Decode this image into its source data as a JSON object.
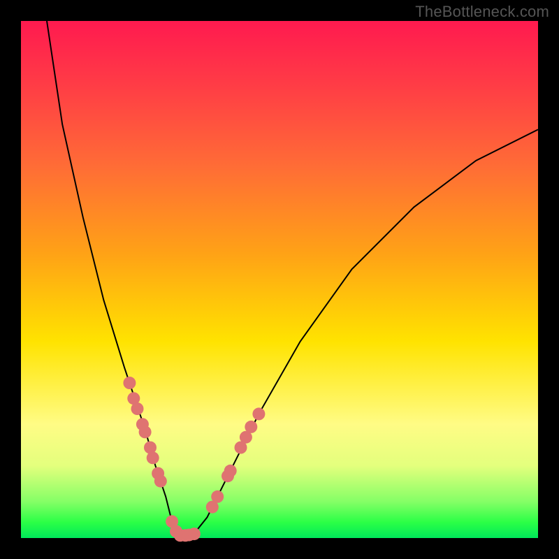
{
  "watermark": "TheBottleneck.com",
  "colors": {
    "frame": "#000000",
    "dot_fill": "#df7371",
    "curve_stroke": "#000000",
    "gradient_top": "#ff1a4f",
    "gradient_bottom": "#00e85a"
  },
  "chart_data": {
    "type": "line",
    "title": "",
    "xlabel": "",
    "ylabel": "",
    "xlim": [
      0,
      100
    ],
    "ylim": [
      0,
      100
    ],
    "grid": false,
    "legend": false,
    "series": [
      {
        "name": "bottleneck-curve",
        "x": [
          5,
          8,
          12,
          16,
          20,
          24,
          26,
          28,
          29,
          30,
          31,
          32,
          34,
          36,
          40,
          46,
          54,
          64,
          76,
          88,
          100
        ],
        "y": [
          100,
          80,
          62,
          46,
          33,
          21,
          14,
          8,
          4,
          1.5,
          0.5,
          0.5,
          1.5,
          4,
          12,
          24,
          38,
          52,
          64,
          73,
          79
        ]
      }
    ],
    "points": [
      {
        "name": "left-cluster",
        "x": 21.0,
        "y": 30
      },
      {
        "name": "left-cluster",
        "x": 21.8,
        "y": 27
      },
      {
        "name": "left-cluster",
        "x": 22.5,
        "y": 25
      },
      {
        "name": "left-cluster",
        "x": 23.5,
        "y": 22
      },
      {
        "name": "left-cluster",
        "x": 24.0,
        "y": 20.5
      },
      {
        "name": "left-cluster",
        "x": 25.0,
        "y": 17.5
      },
      {
        "name": "left-cluster",
        "x": 25.5,
        "y": 15.5
      },
      {
        "name": "left-cluster",
        "x": 26.5,
        "y": 12.5
      },
      {
        "name": "left-cluster",
        "x": 27.0,
        "y": 11
      },
      {
        "name": "bottom-cluster",
        "x": 29.2,
        "y": 3.2
      },
      {
        "name": "bottom-cluster",
        "x": 30.0,
        "y": 1.3
      },
      {
        "name": "bottom-cluster",
        "x": 30.8,
        "y": 0.5
      },
      {
        "name": "bottom-cluster",
        "x": 31.8,
        "y": 0.5
      },
      {
        "name": "bottom-cluster",
        "x": 32.5,
        "y": 0.6
      },
      {
        "name": "bottom-cluster",
        "x": 33.5,
        "y": 0.8
      },
      {
        "name": "right-cluster",
        "x": 37.0,
        "y": 6
      },
      {
        "name": "right-cluster",
        "x": 38.0,
        "y": 8
      },
      {
        "name": "right-cluster",
        "x": 40.0,
        "y": 12
      },
      {
        "name": "right-cluster",
        "x": 40.5,
        "y": 13
      },
      {
        "name": "right-cluster",
        "x": 42.5,
        "y": 17.5
      },
      {
        "name": "right-cluster",
        "x": 43.5,
        "y": 19.5
      },
      {
        "name": "right-cluster",
        "x": 44.5,
        "y": 21.5
      },
      {
        "name": "right-cluster",
        "x": 46.0,
        "y": 24
      }
    ]
  }
}
